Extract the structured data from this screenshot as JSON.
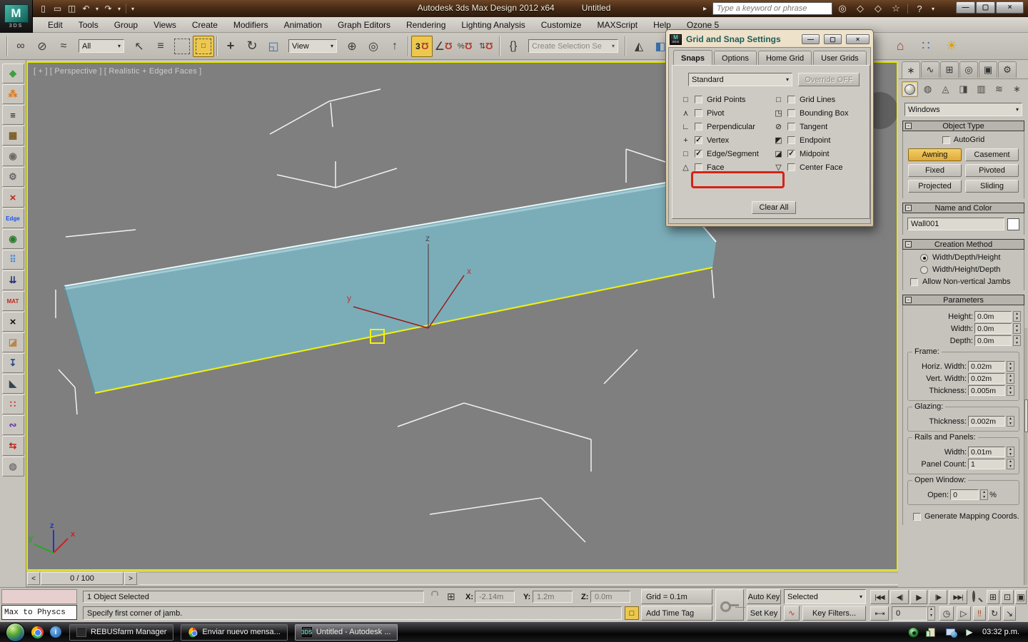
{
  "titlebar": {
    "title": "Autodesk 3ds Max Design 2012 x64",
    "document": "Untitled",
    "search_placeholder": "Type a keyword or phrase"
  },
  "menubar": {
    "items": [
      "Edit",
      "Tools",
      "Group",
      "Views",
      "Create",
      "Modifiers",
      "Animation",
      "Graph Editors",
      "Rendering",
      "Lighting Analysis",
      "Customize",
      "MAXScript",
      "Help",
      "Ozone 5"
    ]
  },
  "toolbar": {
    "filter": "All",
    "coord": "View",
    "snap_mode": "3",
    "selection_set": "Create Selection Se"
  },
  "viewport": {
    "label": "[ + ] [ Perspective ] [ Realistic + Edged Faces ]",
    "axis_x": "x",
    "axis_y": "y",
    "axis_z": "z"
  },
  "timeline": {
    "prev": "<",
    "value": "0 / 100",
    "next": ">"
  },
  "snap_dialog": {
    "title": "Grid and Snap Settings",
    "tabs": [
      "Snaps",
      "Options",
      "Home Grid",
      "User Grids"
    ],
    "standard": "Standard",
    "override": "Override OFF",
    "clear_all": "Clear All",
    "left": [
      {
        "icon": "□",
        "label": "Grid Points",
        "checked": false
      },
      {
        "icon": "⋏",
        "label": "Pivot",
        "checked": false
      },
      {
        "icon": "∟",
        "label": "Perpendicular",
        "checked": false
      },
      {
        "icon": "+",
        "label": "Vertex",
        "checked": true
      },
      {
        "icon": "□",
        "label": "Edge/Segment",
        "checked": true
      },
      {
        "icon": "△",
        "label": "Face",
        "checked": false
      }
    ],
    "right": [
      {
        "icon": "□",
        "label": "Grid Lines",
        "checked": false
      },
      {
        "icon": "◳",
        "label": "Bounding Box",
        "checked": false
      },
      {
        "icon": "⊘",
        "label": "Tangent",
        "checked": false
      },
      {
        "icon": "◩",
        "label": "Endpoint",
        "checked": false
      },
      {
        "icon": "◪",
        "label": "Midpoint",
        "checked": true
      },
      {
        "icon": "▽",
        "label": "Center Face",
        "checked": false
      }
    ]
  },
  "command_panel": {
    "category_dropdown": "Windows",
    "object_type": {
      "title": "Object Type",
      "autogrid": "AutoGrid",
      "autogrid_checked": false,
      "buttons": [
        "Awning",
        "Casement",
        "Fixed",
        "Pivoted",
        "Projected",
        "Sliding"
      ]
    },
    "name_color": {
      "title": "Name and Color",
      "name": "Wall001"
    },
    "creation": {
      "title": "Creation Method",
      "radio1": "Width/Depth/Height",
      "radio1_on": true,
      "radio2": "Width/Height/Depth",
      "radio2_on": false,
      "jambs": "Allow Non-vertical Jambs",
      "jambs_checked": false
    },
    "parameters": {
      "title": "Parameters",
      "height_label": "Height:",
      "height": "0.0m",
      "width_label": "Width:",
      "width": "0.0m",
      "depth_label": "Depth:",
      "depth": "0.0m",
      "frame_title": "Frame:",
      "fh_label": "Horiz. Width:",
      "fh": "0.02m",
      "fv_label": "Vert. Width:",
      "fv": "0.02m",
      "ft_label": "Thickness:",
      "ft": "0.005m",
      "glazing_title": "Glazing:",
      "gt_label": "Thickness:",
      "gt": "0.002m",
      "rails_title": "Rails and Panels:",
      "rw_label": "Width:",
      "rw": "0.01m",
      "rc_label": "Panel Count:",
      "rc": "1",
      "open_title": "Open Window:",
      "open_label": "Open:",
      "open": "0",
      "open_pct": "%",
      "mapping": "Generate Mapping Coords.",
      "mapping_checked": false
    }
  },
  "statusbar": {
    "listener_cmd": "Max to Physcs",
    "selection": "1 Object Selected",
    "prompt": "Specify first corner of jamb.",
    "x_label": "X:",
    "x": "-2.14m",
    "y_label": "Y:",
    "y": "1.2m",
    "z_label": "Z:",
    "z": "0.0m",
    "grid": "Grid = 0.1m",
    "time_tag": "Add Time Tag",
    "auto_key": "Auto Key",
    "set_key": "Set Key",
    "selected": "Selected",
    "key_filters": "Key Filters...",
    "frame": "0"
  },
  "taskbar": {
    "tasks": [
      "REBUSfarm Manager",
      "Enviar nuevo mensa...",
      "Untitled - Autodesk ..."
    ],
    "time": "03:32 p.m."
  },
  "icons": {
    "app_m": "M",
    "app_3ds": "3DS",
    "new": "▯",
    "open": "▭",
    "save": "◫",
    "undo": "↶",
    "redo": "↷",
    "drop": "▾",
    "infocenter_arrow": "▸",
    "binoculars": "◎",
    "sextant": "◇",
    "star": "☆",
    "help": "?",
    "min": "—",
    "max": "▢",
    "close": "×",
    "link": "∞",
    "unlink": "⊘",
    "bind": "≈",
    "select": "↖",
    "select_name": "≡",
    "cube": "□",
    "move": "+",
    "rotate": "↻",
    "scale": "◱",
    "pivot": "⊕",
    "manip": "◎",
    "kbd": "↑",
    "magnet": "Ω",
    "angle": "∠",
    "percent": "%",
    "spin": "⇅",
    "named_sel": "{}",
    "mirror": "◭",
    "align": "◧",
    "layers": "▤",
    "building": "⌂",
    "array": "∷",
    "sun": "☀",
    "tab_create": "∗",
    "tab_modify": "∿",
    "tab_hierarchy": "⊞",
    "tab_motion": "◎",
    "tab_display": "▣",
    "tab_utilities": "⚙",
    "cat_shapes": "◍",
    "cat_lights": "◬",
    "cat_cameras": "◨",
    "cat_helpers": "▥",
    "cat_warps": "≋",
    "cat_systems": "∗",
    "check": "✓",
    "up": "▲",
    "dn": "▼",
    "xyz": "⊞",
    "curve": "∿",
    "tr_start": "|◀◀",
    "tr_prev": "◀||",
    "tr_play": "▶",
    "tr_next": "||▶",
    "tr_end": "▶▶|",
    "tr_keymode": "⇤⇥",
    "gz_grid": "⊞",
    "gz_ext": "⊡",
    "gz_all": "▣",
    "r2_clock": "◷",
    "r2_arrow": "▷",
    "r2_steps": "‼",
    "r2_orbit": "↻",
    "r2_pan": "↘",
    "left_strip": [
      "◆",
      "⁂",
      "≡",
      "▦",
      "◉",
      "⚙",
      "×",
      "Edge",
      "◉",
      "⠿",
      "⇊",
      "MAT",
      "×",
      "◪",
      "↧",
      "◣",
      "∷",
      "∾",
      "⇆",
      "◍"
    ]
  }
}
